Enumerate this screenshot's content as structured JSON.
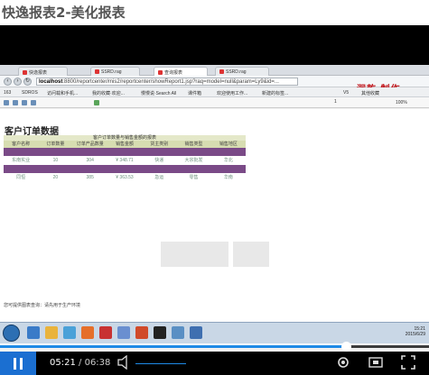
{
  "page_title": "快逸报表2-美化报表",
  "browser": {
    "tabs": [
      {
        "label": "快逸报表"
      },
      {
        "label": "SSRD.rag"
      },
      {
        "label": "查询报表"
      },
      {
        "label": "SSRD.rag"
      }
    ],
    "url_host": "localhost",
    "url_rest": ":8800/reportcenter/mis2/reportcenter/showReport1.jsp?raq=model=null&param=Ly9&id=...",
    "watermark": "润乾 制作",
    "bookmarks": [
      "163",
      "SDROS",
      "访问载和手机...",
      "我的收藏·欢迎...",
      "慢慢说·Search All",
      "课件箱",
      "欢迎使用工作...",
      "新建的标签...",
      "V5",
      "其他收藏"
    ],
    "zoom": "100%",
    "page_nav": "1"
  },
  "report": {
    "title": "客户订单数据",
    "caption": "客户订单数量与销售金额的报表",
    "headers": [
      "客户名称",
      "订单数量",
      "订单产品数量",
      "销售金额",
      "货主类别",
      "销售类型",
      "销售地区"
    ],
    "rows": [
      [
        "东南实业",
        "10",
        "304",
        "¥ 348.71",
        "快递",
        "大宗批发",
        "华北"
      ],
      [
        "同恒",
        "20",
        "385",
        "¥ 363.53",
        "急运",
        "零售",
        "华南"
      ]
    ]
  },
  "status_text": "您可提供图表查询：请先用于生产环境",
  "tray": {
    "time": "15:21",
    "date": "2015/6/29"
  },
  "player": {
    "current_time": "05:21",
    "duration": "06:38",
    "progress": 0.807
  },
  "colors": {
    "accent": "#1b6fd1",
    "report_band": "#7a4a87",
    "report_header": "#d7ddb1",
    "watermark": "#c0151b"
  }
}
